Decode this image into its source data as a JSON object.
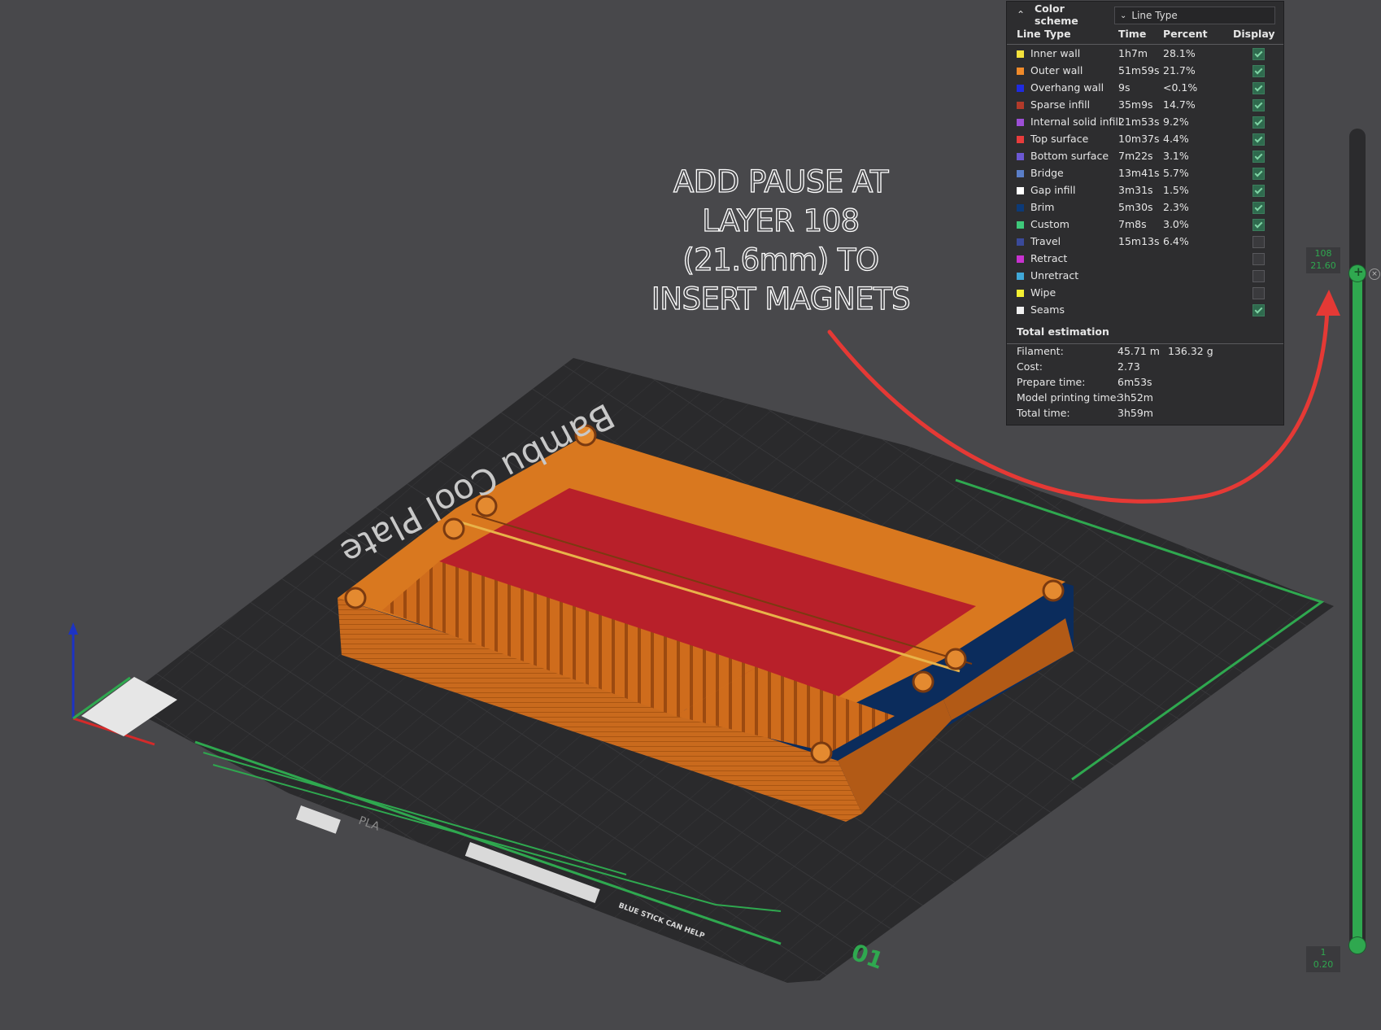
{
  "color_scheme": {
    "label": "Color scheme",
    "selected": "Line Type"
  },
  "legend": {
    "columns": {
      "line_type": "Line Type",
      "time": "Time",
      "percent": "Percent",
      "display": "Display"
    },
    "rows": [
      {
        "name": "Inner wall",
        "time": "1h7m",
        "percent": "28.1%",
        "color": "#f5e23c",
        "display": true
      },
      {
        "name": "Outer wall",
        "time": "51m59s",
        "percent": "21.7%",
        "color": "#f08a2a",
        "display": true
      },
      {
        "name": "Overhang wall",
        "time": "9s",
        "percent": "<0.1%",
        "color": "#1f2be0",
        "display": true
      },
      {
        "name": "Sparse infill",
        "time": "35m9s",
        "percent": "14.7%",
        "color": "#b23a2a",
        "display": true
      },
      {
        "name": "Internal solid infill",
        "time": "21m53s",
        "percent": "9.2%",
        "color": "#9d4fd6",
        "display": true
      },
      {
        "name": "Top surface",
        "time": "10m37s",
        "percent": "4.4%",
        "color": "#e83c3c",
        "display": true
      },
      {
        "name": "Bottom surface",
        "time": "7m22s",
        "percent": "3.1%",
        "color": "#6c58d4",
        "display": true
      },
      {
        "name": "Bridge",
        "time": "13m41s",
        "percent": "5.7%",
        "color": "#5a7ec8",
        "display": true
      },
      {
        "name": "Gap infill",
        "time": "3m31s",
        "percent": "1.5%",
        "color": "#ffffff",
        "display": true
      },
      {
        "name": "Brim",
        "time": "5m30s",
        "percent": "2.3%",
        "color": "#0c3a78",
        "display": true
      },
      {
        "name": "Custom",
        "time": "7m8s",
        "percent": "3.0%",
        "color": "#3ec87a",
        "display": true
      },
      {
        "name": "Travel",
        "time": "15m13s",
        "percent": "6.4%",
        "color": "#3a4a9a",
        "display": false
      },
      {
        "name": "Retract",
        "time": "",
        "percent": "",
        "color": "#c832d0",
        "display": false
      },
      {
        "name": "Unretract",
        "time": "",
        "percent": "",
        "color": "#40a8d8",
        "display": false
      },
      {
        "name": "Wipe",
        "time": "",
        "percent": "",
        "color": "#f5f032",
        "display": false
      },
      {
        "name": "Seams",
        "time": "",
        "percent": "",
        "color": "#f0f0f0",
        "display": true
      }
    ]
  },
  "total_estimation": {
    "title": "Total estimation",
    "filament_label": "Filament:",
    "filament_length": "45.71 m",
    "filament_weight": "136.32 g",
    "cost_label": "Cost:",
    "cost": "2.73",
    "prepare_label": "Prepare time:",
    "prepare": "6m53s",
    "model_label": "Model printing time:",
    "model": "3h52m",
    "total_label": "Total time:",
    "total": "3h59m"
  },
  "callout": {
    "lines": [
      "ADD PAUSE AT",
      "LAYER 108",
      "(21.6mm) TO",
      "INSERT MAGNETS"
    ],
    "arrow_color": "#e53935"
  },
  "layer_slider": {
    "top_layer": "108",
    "top_height": "21.60",
    "bottom_layer": "1",
    "bottom_height": "0.20",
    "accent": "#2fa84f"
  },
  "plate": {
    "brand_text": "Bambu Cool Plate",
    "filament_text": "PLA",
    "tip_text": "BLUE STICK CAN HELP",
    "plate_number": "01"
  },
  "colors": {
    "viewport_bg": "#48484b",
    "plate": "#2a2a2c",
    "model_orange": "#d6721e",
    "top_surface_red": "#b8202a"
  }
}
